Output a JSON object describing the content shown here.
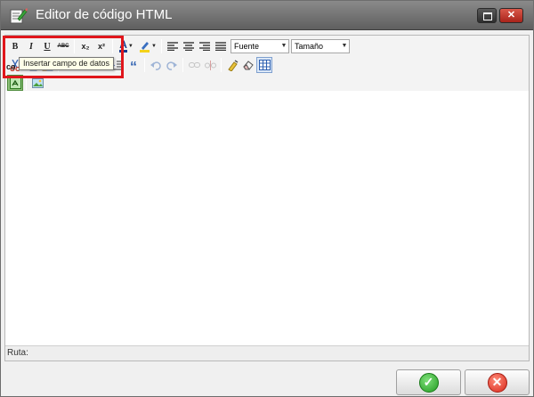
{
  "window": {
    "title": "Editor de código HTML",
    "icon": "pencil-notepad-icon",
    "controls": [
      "restore-icon",
      "close-icon"
    ]
  },
  "toolbar": {
    "row1": {
      "bold": "B",
      "italic": "I",
      "underline": "U",
      "strike": "ABC",
      "subscript": "x₂",
      "superscript": "x²",
      "font_color": "A",
      "font_select": "Fuente",
      "size_select": "Tamaño"
    },
    "row2_icons": [
      "cut-icon",
      "copy-icon",
      "paste-icon",
      "bullet-list-icon",
      "numbered-list-icon",
      "outdent-icon",
      "indent-icon",
      "blockquote-icon",
      "undo-icon",
      "redo-icon",
      "link-icon",
      "unlink-icon",
      "cleanup-icon",
      "eraser-icon",
      "table-icon"
    ],
    "blockquote": "“"
  },
  "tooltip": "Insertar campo de datos",
  "content_fragment": "co",
  "statusbar": {
    "path_label": "Ruta:"
  },
  "colors": {
    "titlebar": "#6f6f6f",
    "highlight": "#e0161c",
    "ok": "#239b22",
    "cancel": "#d8281b"
  }
}
